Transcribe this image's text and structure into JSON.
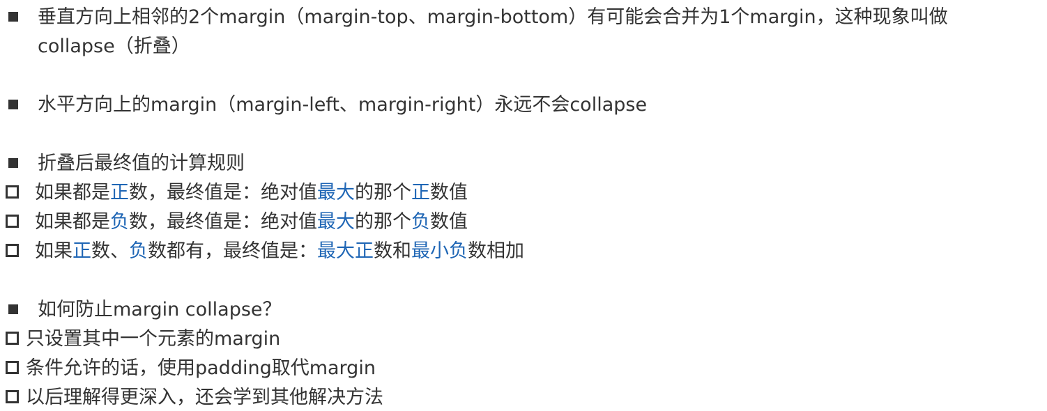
{
  "items": [
    {
      "kind": "square",
      "line1": "垂直方向上相邻的2个margin（margin-top、margin-bottom）有可能会合并为1个margin，这种现象叫做",
      "line2": "collapse（折叠）"
    },
    {
      "kind": "square",
      "text": "水平方向上的margin（margin-left、margin-right）永远不会collapse"
    },
    {
      "kind": "square",
      "text": "折叠后最终值的计算规则"
    },
    {
      "kind": "hollow",
      "parts": [
        "如果都是",
        "正",
        "数，最终值是：绝对值",
        "最大",
        "的那个",
        "正",
        "数值"
      ]
    },
    {
      "kind": "hollow",
      "parts": [
        "如果都是",
        "负",
        "数，最终值是：绝对值",
        "最大",
        "的那个",
        "负",
        "数值"
      ]
    },
    {
      "kind": "hollow",
      "parts": [
        "如果",
        "正",
        "数、",
        "负",
        "数都有，最终值是：",
        "最大正",
        "数和",
        "最小负",
        "数相加"
      ]
    },
    {
      "kind": "square",
      "text": "如何防止margin collapse？"
    },
    {
      "kind": "hollow",
      "text": "只设置其中一个元素的margin"
    },
    {
      "kind": "hollow",
      "text": "条件允许的话，使用padding取代margin"
    },
    {
      "kind": "hollow",
      "text": "以后理解得更深入，还会学到其他解决方法"
    }
  ],
  "colors": {
    "text": "#333333",
    "highlight": "#1f66b5",
    "background": "#ffffff"
  }
}
